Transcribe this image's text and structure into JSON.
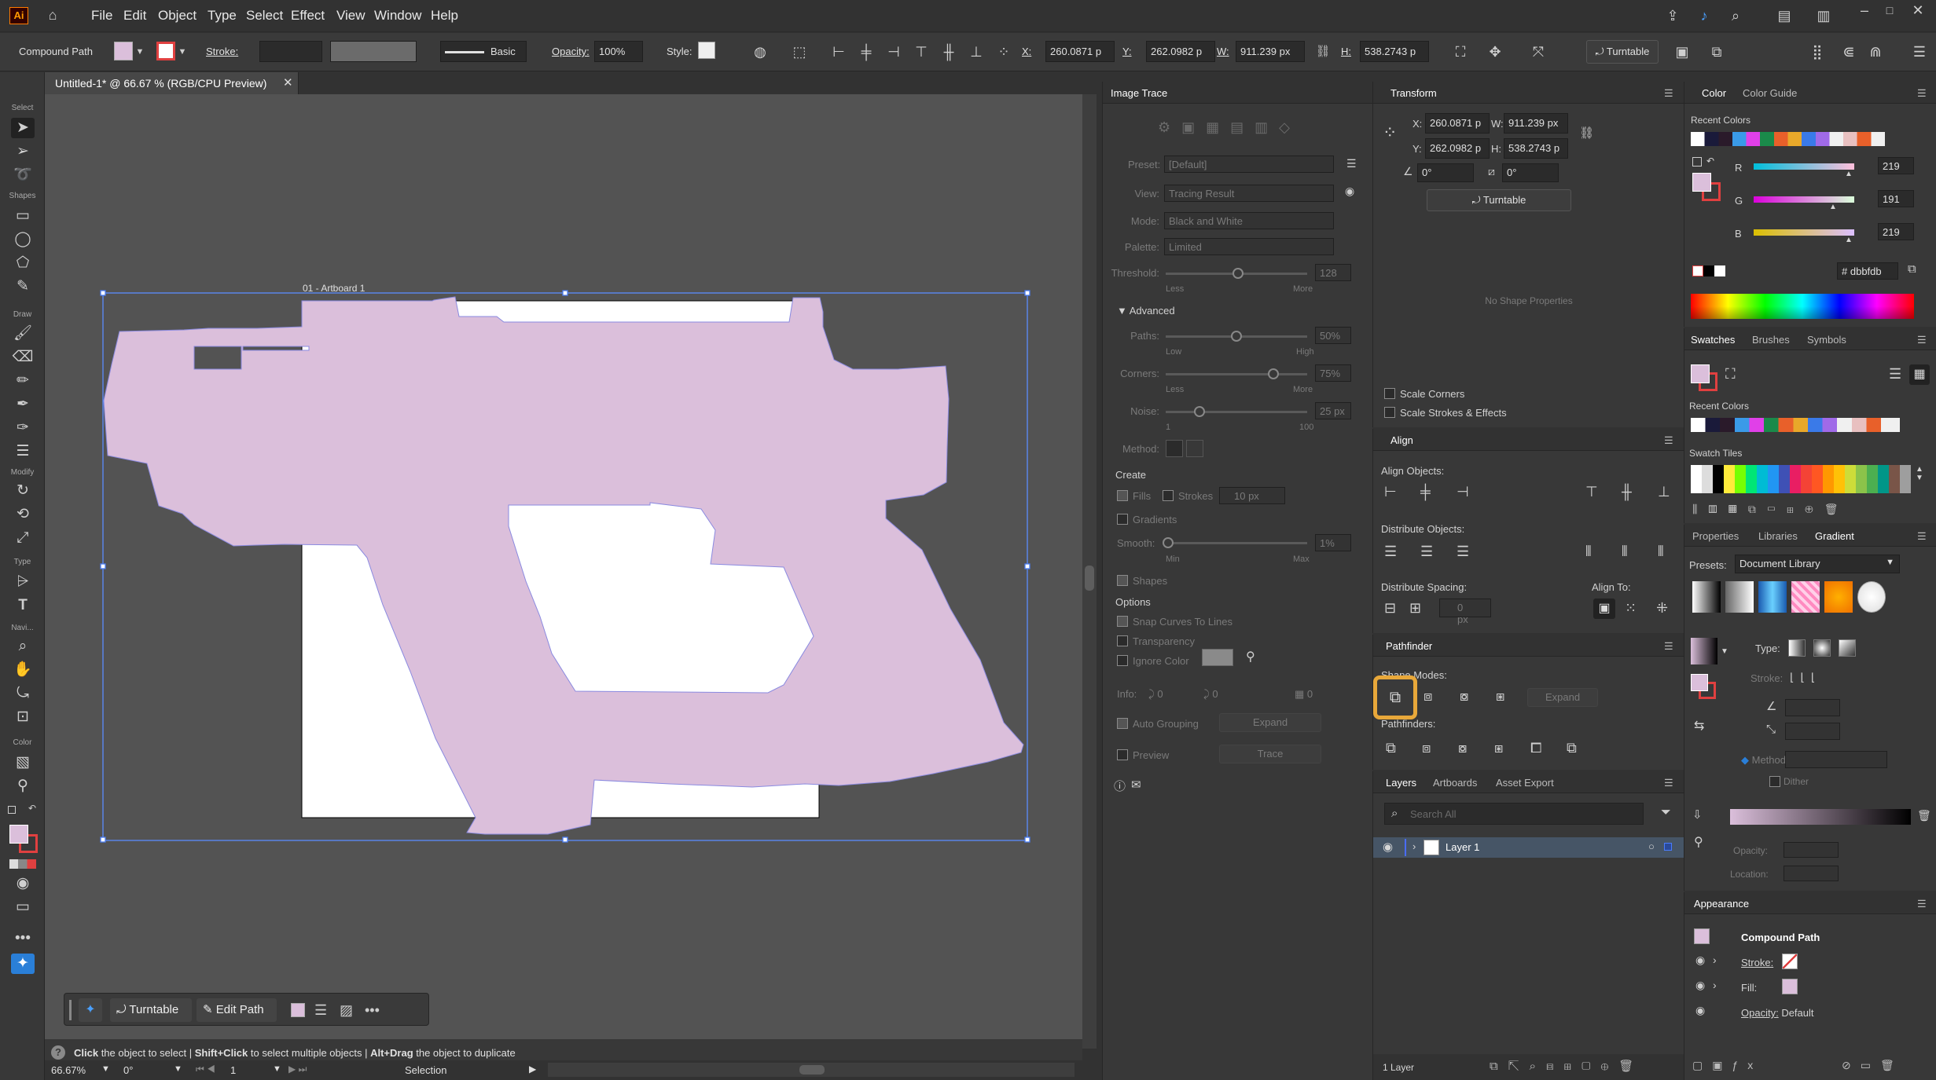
{
  "menubar": {
    "app_logo": "Ai",
    "menus": [
      "File",
      "Edit",
      "Object",
      "Type",
      "Select",
      "Effect",
      "View",
      "Window",
      "Help"
    ]
  },
  "control": {
    "object_type": "Compound Path",
    "stroke_label": "Stroke:",
    "brush_label": "Basic",
    "opacity_label": "Opacity:",
    "opacity_value": "100%",
    "style_label": "Style:",
    "x_label": "X:",
    "x_value": "260.0871 p",
    "y_label": "Y:",
    "y_value": "262.0982 p",
    "w_label": "W:",
    "w_value": "911.239 px",
    "h_label": "H:",
    "h_value": "538.2743 p",
    "turntable_label": "Turntable"
  },
  "tools": {
    "sections": [
      "Select",
      "Shapes",
      "Draw",
      "Modify",
      "Type",
      "Navi...",
      "Color"
    ]
  },
  "document": {
    "tab_title": "Untitled-1* @ 66.67 % (RGB/CPU Preview)",
    "artboard_label": "01 - Artboard 1"
  },
  "context_bar": {
    "turntable": "Turntable",
    "edit_path": "Edit Path"
  },
  "status": {
    "hint_part1": "Click",
    "hint_part2": " the object to select  |  ",
    "hint_part3": "Shift+Click",
    "hint_part4": " to select multiple objects  |  ",
    "hint_part5": "Alt+Drag",
    "hint_part6": " the object to duplicate",
    "zoom": "66.67%",
    "rotation": "0°",
    "artboard_number": "1",
    "tool_name": "Selection"
  },
  "image_trace": {
    "title": "Image Trace",
    "preset_label": "Preset:",
    "preset_value": "[Default]",
    "view_label": "View:",
    "view_value": "Tracing Result",
    "mode_label": "Mode:",
    "mode_value": "Black and White",
    "palette_label": "Palette:",
    "palette_value": "Limited",
    "threshold_label": "Threshold:",
    "threshold_value": "128",
    "less": "Less",
    "more": "More",
    "advanced": "Advanced",
    "paths_label": "Paths:",
    "paths_value": "50%",
    "low": "Low",
    "high": "High",
    "corners_label": "Corners:",
    "corners_value": "75%",
    "noise_label": "Noise:",
    "noise_value": "25 px",
    "noise_min": "1",
    "noise_max": "100",
    "method_label": "Method:",
    "create_label": "Create",
    "fills": "Fills",
    "strokes": "Strokes",
    "strokes_value": "10 px",
    "gradients": "Gradients",
    "smooth_label": "Smooth:",
    "smooth_value": "1%",
    "min": "Min",
    "max": "Max",
    "shapes": "Shapes",
    "options_label": "Options",
    "snap_curves": "Snap Curves To Lines",
    "transparency": "Transparency",
    "ignore_color": "Ignore Color",
    "info_label": "Info:",
    "info_paths": "0",
    "info_anchors": "0",
    "info_colors": "0",
    "auto_grouping": "Auto Grouping",
    "expand": "Expand",
    "preview": "Preview",
    "trace": "Trace"
  },
  "transform": {
    "title": "Transform",
    "x_label": "X:",
    "x_value": "260.0871 p",
    "y_label": "Y:",
    "y_value": "262.0982 p",
    "w_label": "W:",
    "w_value": "911.239 px",
    "h_label": "H:",
    "h_value": "538.2743 p",
    "rotate_value": "0°",
    "shear_value": "0°",
    "turntable": "Turntable",
    "no_shape": "No Shape Properties",
    "scale_corners": "Scale Corners",
    "scale_strokes": "Scale Strokes & Effects"
  },
  "align": {
    "title": "Align",
    "align_objects": "Align Objects:",
    "distribute_objects": "Distribute Objects:",
    "distribute_spacing": "Distribute Spacing:",
    "spacing_value": "0 px",
    "align_to": "Align To:"
  },
  "pathfinder": {
    "title": "Pathfinder",
    "shape_modes": "Shape Modes:",
    "expand": "Expand",
    "pathfinders": "Pathfinders:"
  },
  "layers": {
    "tabs": [
      "Layers",
      "Artboards",
      "Asset Export"
    ],
    "search_placeholder": "Search All",
    "layer_name": "Layer 1",
    "count": "1 Layer"
  },
  "color": {
    "tabs": [
      "Color",
      "Color Guide"
    ],
    "recent_colors": "Recent Colors",
    "r_label": "R",
    "r_value": "219",
    "g_label": "G",
    "g_value": "191",
    "b_label": "B",
    "b_value": "219",
    "hex_prefix": "#",
    "hex_value": "dbbfdb"
  },
  "swatches": {
    "tabs": [
      "Swatches",
      "Brushes",
      "Symbols"
    ],
    "recent_colors": "Recent Colors",
    "swatch_tiles": "Swatch Tiles"
  },
  "gradient": {
    "tabs": [
      "Properties",
      "Libraries",
      "Gradient"
    ],
    "presets_label": "Presets:",
    "presets_value": "Document Library",
    "type_label": "Type:",
    "stroke_label": "Stroke:",
    "method_label": "Method:",
    "dither": "Dither",
    "opacity_label": "Opacity:",
    "location_label": "Location:"
  },
  "appearance": {
    "title": "Appearance",
    "object": "Compound Path",
    "stroke": "Stroke:",
    "fill": "Fill:",
    "opacity": "Opacity:",
    "opacity_value": "Default"
  },
  "colors": {
    "fill": "#dbbfdb",
    "accent": "#2a7fd8",
    "highlight": "#e8a83a"
  }
}
